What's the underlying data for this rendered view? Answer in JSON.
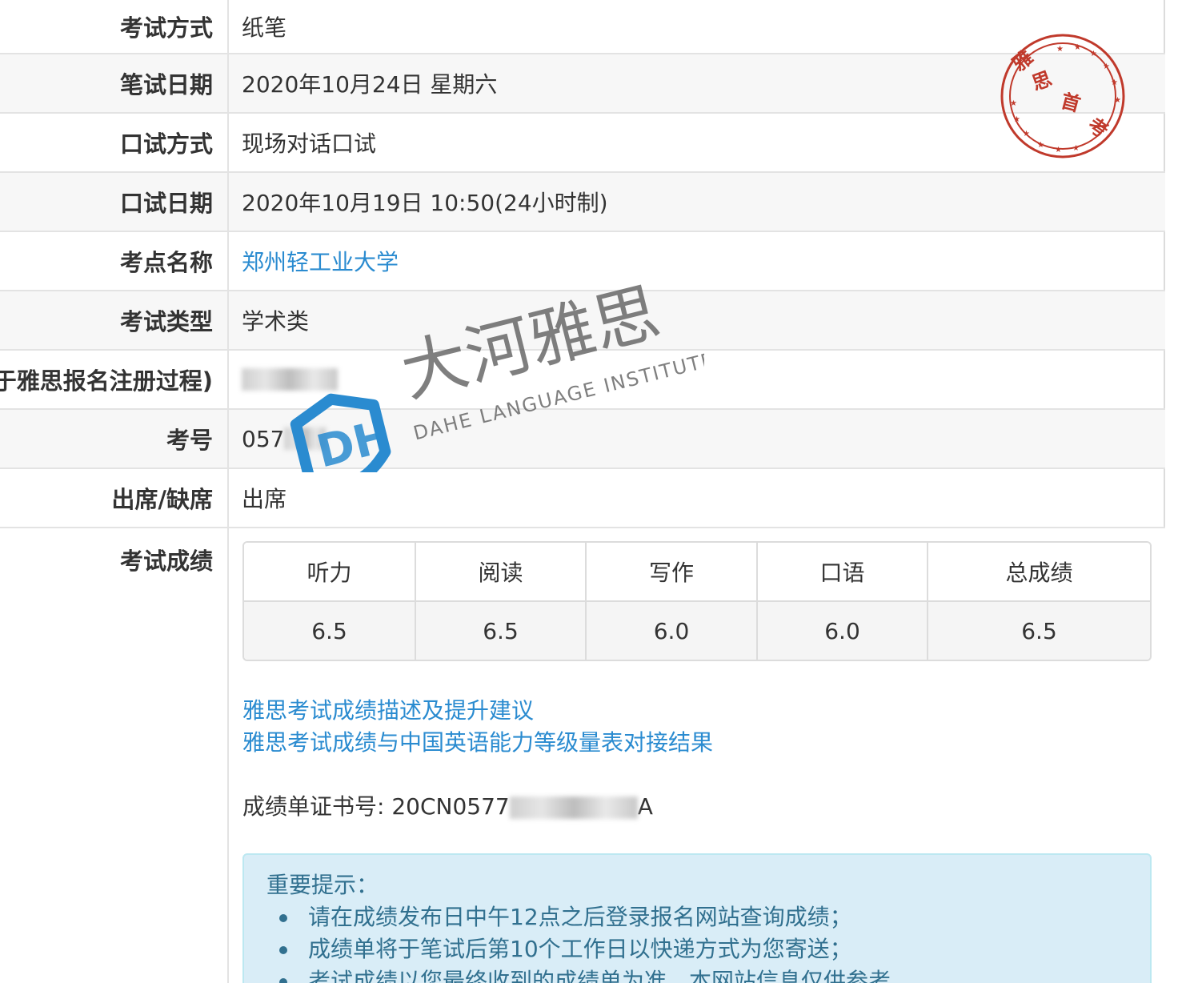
{
  "info_rows": [
    {
      "label": "考试方式",
      "value": "纸笔"
    },
    {
      "label": "笔试日期",
      "value": "2020年10月24日 星期六"
    },
    {
      "label": "口试方式",
      "value": "现场对话口试"
    },
    {
      "label": "口试日期",
      "value": "2020年10月19日 10:50(24小时制)"
    },
    {
      "label": "考点名称",
      "value": "郑州轻工业大学"
    },
    {
      "label": "考试类型",
      "value": "学术类"
    },
    {
      "label": "于雅思报名注册过程)",
      "value": ""
    },
    {
      "label": "考号",
      "value": "057"
    },
    {
      "label": "出席/缺席",
      "value": "出席"
    }
  ],
  "scores": {
    "label": "考试成绩",
    "headers": [
      "听力",
      "阅读",
      "写作",
      "口语",
      "总成绩"
    ],
    "values": [
      "6.5",
      "6.5",
      "6.0",
      "6.0",
      "6.5"
    ]
  },
  "links": {
    "description": "雅思考试成绩描述及提升建议",
    "mapping": "雅思考试成绩与中国英语能力等级量表对接结果"
  },
  "certificate": {
    "prefix": "成绩单证书号: 20CN0577",
    "suffix": "A"
  },
  "notice": {
    "title": "重要提示：",
    "items": [
      "请在成绩发布日中午12点之后登录报名网站查询成绩；",
      "成绩单将于笔试后第10个工作日以快递方式为您寄送；",
      "考试成绩以您最终收到的成绩单为准，本网站信息仅供参考。"
    ]
  },
  "stamp": {
    "text": "雅思首考"
  },
  "watermark": {
    "chinese": "大河雅思",
    "english": "DAHE LANGUAGE INSTITUTE",
    "logo": "DH"
  },
  "colors": {
    "link": "#2a8bd0",
    "stamp": "#c0392b",
    "notice_bg": "#d9edf7",
    "notice_text": "#31708f",
    "watermark_blue": "#2a8bd0"
  }
}
